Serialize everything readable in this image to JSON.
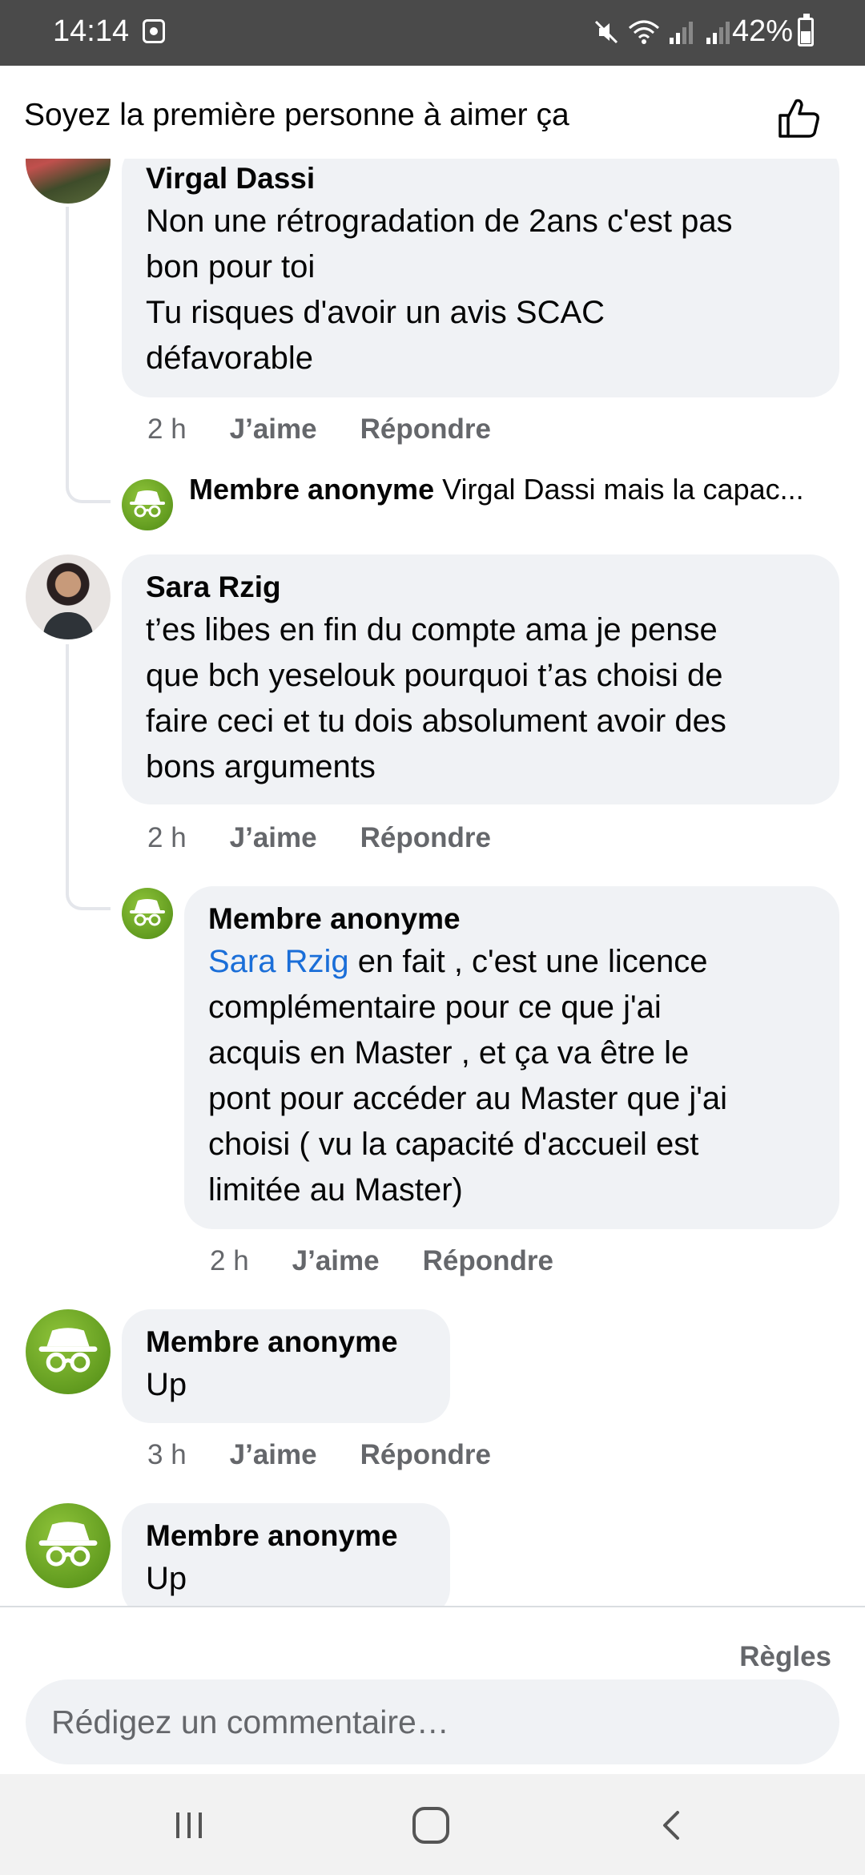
{
  "status_bar": {
    "time": "14:14",
    "battery": "42%"
  },
  "header": {
    "title": "Soyez la première personne à aimer ça"
  },
  "comments": [
    {
      "author": "Virgal Dassi",
      "lines": [
        "Non une rétrogradation de 2ans c'est pas",
        "bon pour toi",
        "Tu risques d'avoir un avis SCAC",
        "défavorable"
      ],
      "time": "2 h",
      "like_label": "J’aime",
      "reply_label": "Répondre",
      "reply_preview": {
        "author": "Membre anonyme",
        "text": "Virgal Dassi mais la capac..."
      }
    },
    {
      "author": "Sara Rzig",
      "lines": [
        "t’es libes en fin du compte ama je pense",
        "que bch yeselouk pourquoi t’as choisi de",
        "faire ceci et tu dois absolument avoir des",
        "bons arguments"
      ],
      "time": "2 h",
      "like_label": "J’aime",
      "reply_label": "Répondre",
      "reply": {
        "author": "Membre anonyme",
        "mention": "Sara Rzig",
        "first_line_rest": " en fait , c'est une licence",
        "lines": [
          "complémentaire pour ce que j'ai",
          "acquis en Master , et ça va être le",
          "pont pour accéder au Master que j'ai",
          "choisi ( vu la capacité d'accueil est",
          "limitée au Master)"
        ],
        "time": "2 h",
        "like_label": "J’aime",
        "reply_label": "Répondre"
      }
    },
    {
      "author": "Membre anonyme",
      "text": "Up",
      "time": "3 h",
      "like_label": "J’aime",
      "reply_label": "Répondre"
    },
    {
      "author": "Membre anonyme",
      "text": "Up"
    }
  ],
  "footer": {
    "rules_label": "Règles",
    "comment_placeholder": "Rédigez un commentaire…"
  },
  "icons": {
    "header": "thumbs-up-icon",
    "anonymous_avatar": "incognito-icon",
    "nav": [
      "recent-apps-icon",
      "home-icon",
      "back-icon"
    ]
  },
  "colors": {
    "mention": "#1a6ed8",
    "bubble": "#f0f2f5",
    "meta_text": "#65676b",
    "anonymous_avatar": "#6aa82a"
  }
}
